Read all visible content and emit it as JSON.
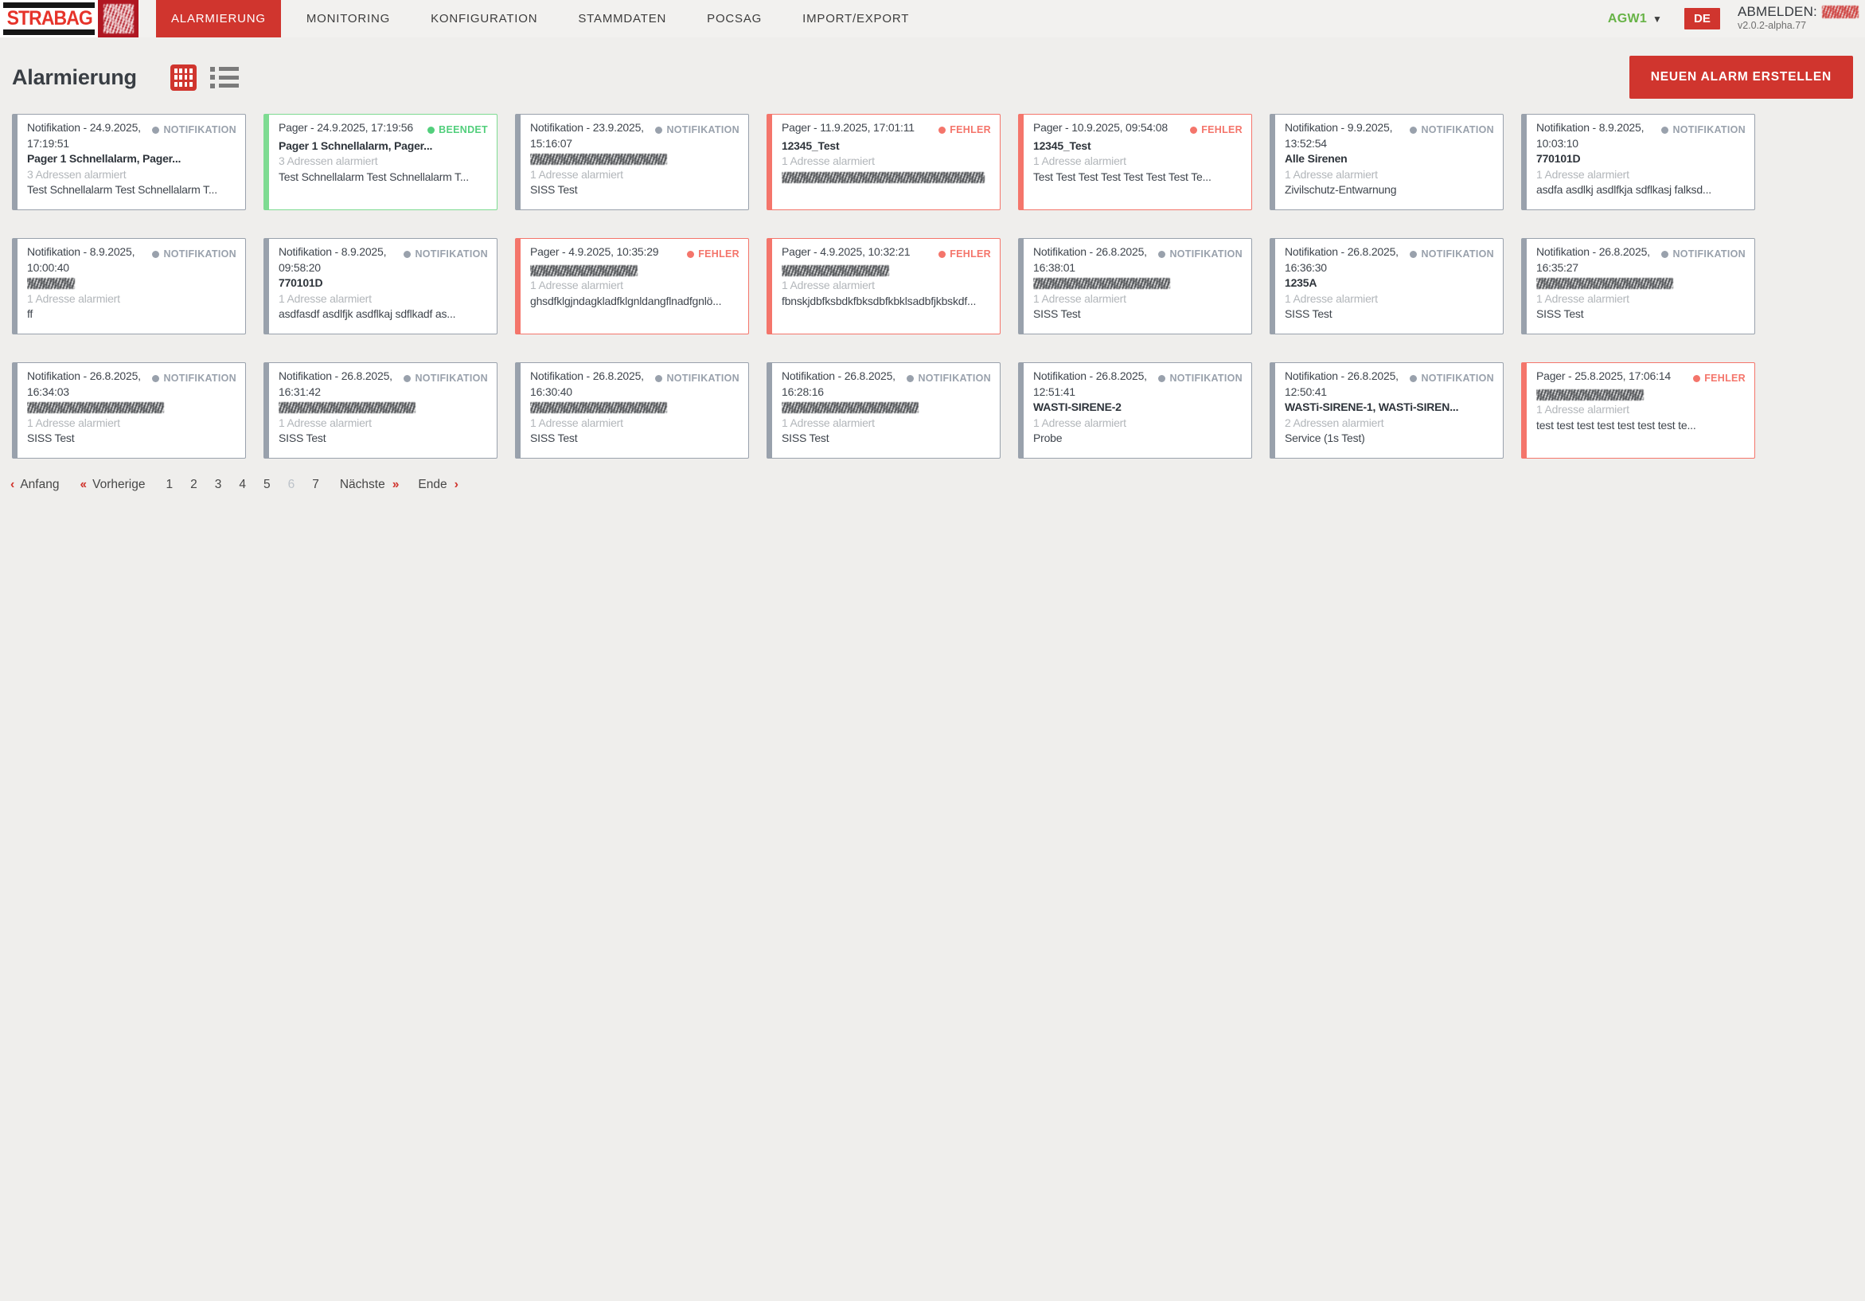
{
  "brand": {
    "logo_text": "STRABAG"
  },
  "nav": {
    "items": [
      {
        "label": "ALARMIERUNG",
        "active": true
      },
      {
        "label": "MONITORING",
        "active": false
      },
      {
        "label": "KONFIGURATION",
        "active": false
      },
      {
        "label": "STAMMDATEN",
        "active": false
      },
      {
        "label": "POCSAG",
        "active": false
      },
      {
        "label": "IMPORT/EXPORT",
        "active": false
      }
    ]
  },
  "userbar": {
    "group": "AGW1",
    "language": "DE",
    "logout_label": "ABMELDEN:",
    "version": "v2.0.2-alpha.77"
  },
  "toolbar": {
    "title": "Alarmierung",
    "create_button": "NEUEN ALARM ERSTELLEN"
  },
  "colors": {
    "accent_red": "#d0352e",
    "status_error": "#f4756b",
    "status_success": "#52cf7c",
    "status_neutral": "#99a1ac",
    "group_green": "#67b346"
  },
  "cards": [
    {
      "header": "Notifikation - 24.9.2025, 17:19:51",
      "variant": "default",
      "badge": "NOTIFIKATION",
      "title": "Pager 1 Schnellalarm, Pager...",
      "title_redacted": false,
      "addresses": "3 Adressen alarmiert",
      "description": "Test Schnellalarm Test Schnellalarm T...",
      "description_redacted": false
    },
    {
      "header": "Pager - 24.9.2025, 17:19:56",
      "variant": "success",
      "badge": "BEENDET",
      "title": "Pager 1 Schnellalarm, Pager...",
      "title_redacted": false,
      "addresses": "3 Adressen alarmiert",
      "description": "Test Schnellalarm Test Schnellalarm T...",
      "description_redacted": false
    },
    {
      "header": "Notifikation - 23.9.2025, 15:16:07",
      "variant": "default",
      "badge": "NOTIFIKATION",
      "title": "",
      "title_redacted": true,
      "redacted_size": "lg",
      "addresses": "1 Adresse alarmiert",
      "description": "SISS Test",
      "description_redacted": false
    },
    {
      "header": "Pager - 11.9.2025, 17:01:11",
      "variant": "error",
      "badge": "FEHLER",
      "title": "12345_Test",
      "title_redacted": false,
      "addresses": "1 Adresse alarmiert",
      "description": "",
      "description_redacted": true,
      "redacted_size": "xxl"
    },
    {
      "header": "Pager - 10.9.2025, 09:54:08",
      "variant": "error",
      "badge": "FEHLER",
      "title": "12345_Test",
      "title_redacted": false,
      "addresses": "1 Adresse alarmiert",
      "description": "Test Test Test Test Test Test Test Te...",
      "description_redacted": false
    },
    {
      "header": "Notifikation - 9.9.2025, 13:52:54",
      "variant": "default",
      "badge": "NOTIFIKATION",
      "title": "Alle Sirenen",
      "title_redacted": false,
      "addresses": "1 Adresse alarmiert",
      "description": "Zivilschutz-Entwarnung",
      "description_redacted": false
    },
    {
      "header": "Notifikation - 8.9.2025, 10:03:10",
      "variant": "default",
      "badge": "NOTIFIKATION",
      "title": "770101D",
      "title_redacted": false,
      "addresses": "1 Adresse alarmiert",
      "description": "asdfa asdlkj asdlfkja sdflkasj falksd...",
      "description_redacted": false
    },
    {
      "header": "Notifikation - 8.9.2025, 10:00:40",
      "variant": "default",
      "badge": "NOTIFIKATION",
      "title": "",
      "title_redacted": true,
      "redacted_size": "sm",
      "addresses": "1 Adresse alarmiert",
      "description": "ff",
      "description_redacted": false
    },
    {
      "header": "Notifikation - 8.9.2025, 09:58:20",
      "variant": "default",
      "badge": "NOTIFIKATION",
      "title": "770101D",
      "title_redacted": false,
      "addresses": "1 Adresse alarmiert",
      "description": "asdfasdf asdlfjk asdflkaj sdflkadf as...",
      "description_redacted": false
    },
    {
      "header": "Pager - 4.9.2025, 10:35:29",
      "variant": "error",
      "badge": "FEHLER",
      "title": "",
      "title_redacted": true,
      "redacted_size": "md",
      "addresses": "1 Adresse alarmiert",
      "description": "ghsdfklgjndagkladfklgnldangflnadfgnlö...",
      "description_redacted": false
    },
    {
      "header": "Pager - 4.9.2025, 10:32:21",
      "variant": "error",
      "badge": "FEHLER",
      "title": "",
      "title_redacted": true,
      "redacted_size": "md",
      "addresses": "1 Adresse alarmiert",
      "description": "fbnskjdbfksbdkfbksdbfkbklsadbfjkbskdf...",
      "description_redacted": false
    },
    {
      "header": "Notifikation - 26.8.2025, 16:38:01",
      "variant": "default",
      "badge": "NOTIFIKATION",
      "title": "",
      "title_redacted": true,
      "redacted_size": "lg",
      "addresses": "1 Adresse alarmiert",
      "description": "SISS Test",
      "description_redacted": false
    },
    {
      "header": "Notifikation - 26.8.2025, 16:36:30",
      "variant": "default",
      "badge": "NOTIFIKATION",
      "title": "1235A",
      "title_redacted": false,
      "addresses": "1 Adresse alarmiert",
      "description": "SISS Test",
      "description_redacted": false
    },
    {
      "header": "Notifikation - 26.8.2025, 16:35:27",
      "variant": "default",
      "badge": "NOTIFIKATION",
      "title": "",
      "title_redacted": true,
      "redacted_size": "lg",
      "addresses": "1 Adresse alarmiert",
      "description": "SISS Test",
      "description_redacted": false
    },
    {
      "header": "Notifikation - 26.8.2025, 16:34:03",
      "variant": "default",
      "badge": "NOTIFIKATION",
      "title": "",
      "title_redacted": true,
      "redacted_size": "lg",
      "addresses": "1 Adresse alarmiert",
      "description": "SISS Test",
      "description_redacted": false
    },
    {
      "header": "Notifikation - 26.8.2025, 16:31:42",
      "variant": "default",
      "badge": "NOTIFIKATION",
      "title": "",
      "title_redacted": true,
      "redacted_size": "lg",
      "addresses": "1 Adresse alarmiert",
      "description": "SISS Test",
      "description_redacted": false
    },
    {
      "header": "Notifikation - 26.8.2025, 16:30:40",
      "variant": "default",
      "badge": "NOTIFIKATION",
      "title": "",
      "title_redacted": true,
      "redacted_size": "lg",
      "addresses": "1 Adresse alarmiert",
      "description": "SISS Test",
      "description_redacted": false
    },
    {
      "header": "Notifikation - 26.8.2025, 16:28:16",
      "variant": "default",
      "badge": "NOTIFIKATION",
      "title": "",
      "title_redacted": true,
      "redacted_size": "lg",
      "addresses": "1 Adresse alarmiert",
      "description": "SISS Test",
      "description_redacted": false
    },
    {
      "header": "Notifikation - 26.8.2025, 12:51:41",
      "variant": "default",
      "badge": "NOTIFIKATION",
      "title": "WASTI-SIRENE-2",
      "title_redacted": false,
      "addresses": "1 Adresse alarmiert",
      "description": "Probe",
      "description_redacted": false
    },
    {
      "header": "Notifikation - 26.8.2025, 12:50:41",
      "variant": "default",
      "badge": "NOTIFIKATION",
      "title": "WASTi-SIRENE-1, WASTi-SIREN...",
      "title_redacted": false,
      "addresses": "2 Adressen alarmiert",
      "description": "Service (1s Test)",
      "description_redacted": false
    },
    {
      "header": "Pager - 25.8.2025, 17:06:14",
      "variant": "error",
      "badge": "FEHLER",
      "title": "",
      "title_redacted": true,
      "redacted_size": "md",
      "addresses": "1 Adresse alarmiert",
      "description": "test test test test test test test te...",
      "description_redacted": false
    }
  ],
  "pagination": {
    "first": {
      "icon": "‹",
      "label": "Anfang"
    },
    "prev": {
      "icon": "‹‹",
      "label": "Vorherige"
    },
    "pages": [
      "1",
      "2",
      "3",
      "4",
      "5",
      "6",
      "7"
    ],
    "current": "6",
    "next": {
      "label": "Nächste",
      "icon": "››"
    },
    "last": {
      "label": "Ende",
      "icon": "›"
    }
  }
}
